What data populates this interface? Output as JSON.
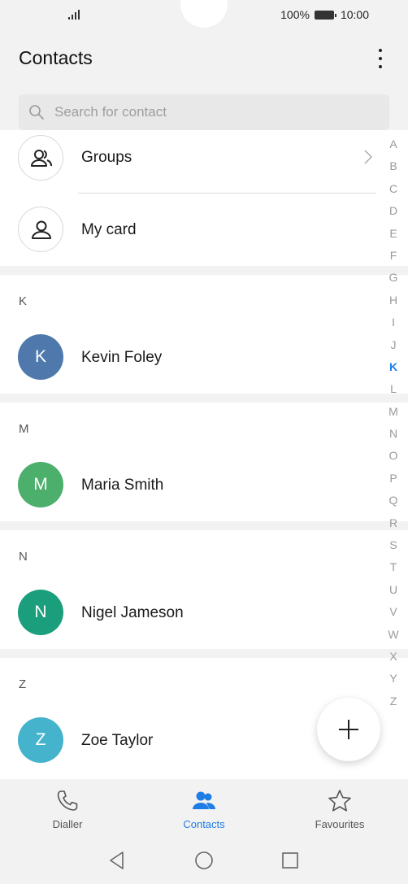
{
  "status": {
    "battery_text": "100%",
    "time": "10:00"
  },
  "header": {
    "title": "Contacts"
  },
  "search": {
    "placeholder": "Search for contact"
  },
  "top_items": {
    "groups": "Groups",
    "my_card": "My card"
  },
  "sections": [
    {
      "letter": "K",
      "name": "Kevin Foley",
      "initial": "K",
      "color": "#4f79ad"
    },
    {
      "letter": "M",
      "name": "Maria Smith",
      "initial": "M",
      "color": "#4caf6c"
    },
    {
      "letter": "N",
      "name": "Nigel Jameson",
      "initial": "N",
      "color": "#1a9e7c"
    },
    {
      "letter": "Z",
      "name": "Zoe Taylor",
      "initial": "Z",
      "color": "#45b3cc"
    }
  ],
  "index": {
    "letters": [
      "A",
      "B",
      "C",
      "D",
      "E",
      "F",
      "G",
      "H",
      "I",
      "J",
      "K",
      "L",
      "M",
      "N",
      "O",
      "P",
      "Q",
      "R",
      "S",
      "T",
      "U",
      "V",
      "W",
      "X",
      "Y",
      "Z"
    ],
    "active": "K",
    "active_color": "#1e7ee6"
  },
  "tabs": [
    {
      "label": "Dialler",
      "icon": "phone-icon",
      "active": false
    },
    {
      "label": "Contacts",
      "icon": "contacts-icon",
      "active": true
    },
    {
      "label": "Favourites",
      "icon": "star-icon",
      "active": false
    }
  ],
  "accent": "#1e7ee6"
}
